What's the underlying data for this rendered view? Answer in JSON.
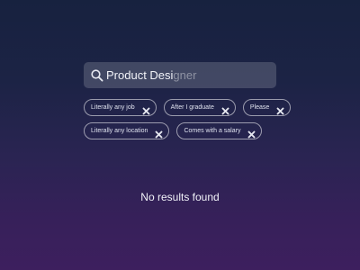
{
  "search": {
    "typed_text": "Product Desi",
    "autocomplete_hint": "gner",
    "icon": "search-icon"
  },
  "chips": [
    {
      "label": "Literally any job"
    },
    {
      "label": "After I graduate"
    },
    {
      "label": "Please"
    },
    {
      "label": "Literally any location"
    },
    {
      "label": "Comes with a salary"
    }
  ],
  "results": {
    "empty_message": "No results found"
  },
  "colors": {
    "background_top": "#17223f",
    "background_bottom": "#3d1f5e",
    "text": "#f1f2f8"
  }
}
